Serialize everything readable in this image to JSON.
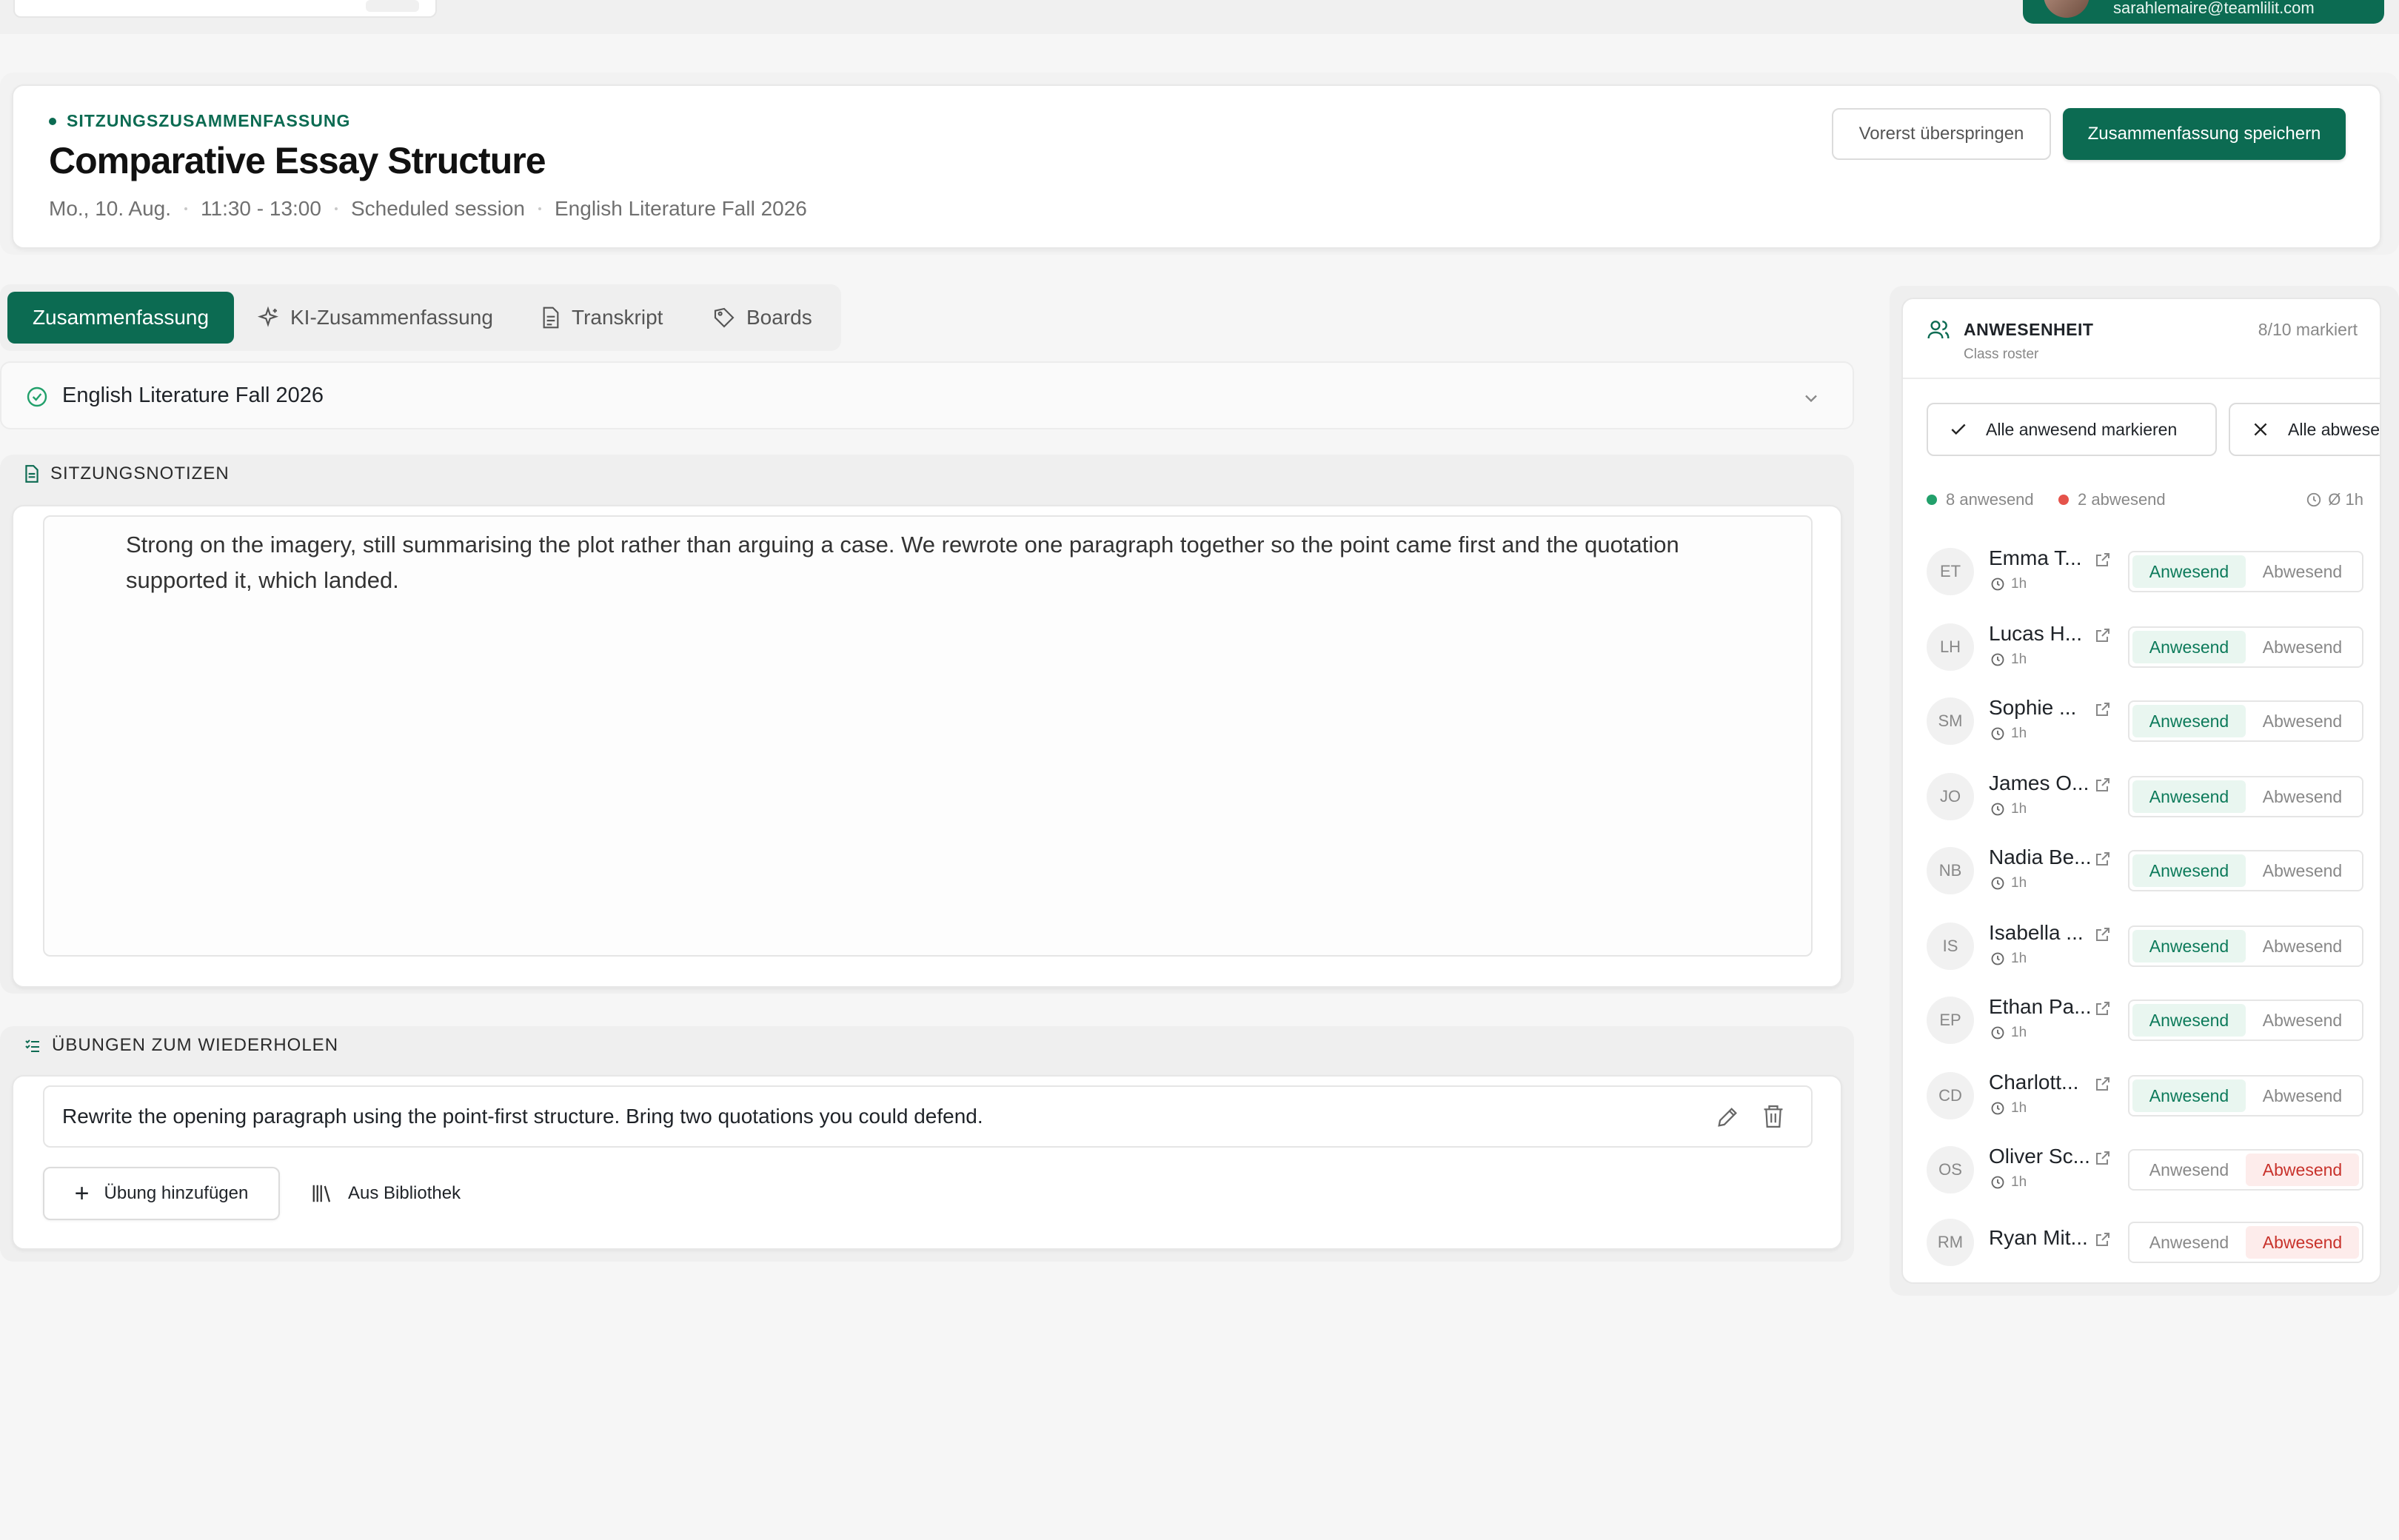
{
  "user": {
    "email": "sarahlemaire@teamlilit.com"
  },
  "header": {
    "kicker": "SITZUNGSZUSAMMENFASSUNG",
    "title": "Comparative Essay Structure",
    "date": "Mo., 10. Aug.",
    "time": "11:30 - 13:00",
    "session_type": "Scheduled session",
    "course": "English Literature Fall 2026",
    "skip_label": "Vorerst überspringen",
    "save_label": "Zusammenfassung speichern"
  },
  "tabs": [
    {
      "label": "Zusammenfassung",
      "icon": "none",
      "active": true
    },
    {
      "label": "KI-Zusammenfassung",
      "icon": "sparkle-icon"
    },
    {
      "label": "Transkript",
      "icon": "document-icon"
    },
    {
      "label": "Boards",
      "icon": "board-icon"
    }
  ],
  "course_select": {
    "label": "English Literature Fall 2026"
  },
  "notes": {
    "title": "SITZUNGSNOTIZEN",
    "text": "Strong on the imagery, still summarising the plot rather than arguing a case. We rewrote one paragraph together so the point came first and the quotation supported it, which landed."
  },
  "exercises": {
    "title": "ÜBUNGEN ZUM WIEDERHOLEN",
    "items": [
      "Rewrite the opening paragraph using the point-first structure. Bring two quotations you could defend."
    ],
    "add_label": "Übung hinzufügen",
    "library_label": "Aus Bibliothek"
  },
  "attendance": {
    "title": "ANWESENHEIT",
    "subtitle": "Class roster",
    "count": "8/10 markiert",
    "all_present_label": "Alle anwesend markieren",
    "all_absent_label": "Alle abwesend",
    "present_count": "8 anwesend",
    "absent_count": "2 abwesend",
    "avg": "Ø 1h",
    "present_label": "Anwesend",
    "absent_label": "Abwesend",
    "colors": {
      "present": "#22a06b",
      "absent": "#e5534b",
      "brand": "#0c6b52"
    },
    "students": [
      {
        "initials": "ET",
        "name": "Emma T...",
        "duration": "1h",
        "status": "present"
      },
      {
        "initials": "LH",
        "name": "Lucas H...",
        "duration": "1h",
        "status": "present"
      },
      {
        "initials": "SM",
        "name": "Sophie ...",
        "duration": "1h",
        "status": "present"
      },
      {
        "initials": "JO",
        "name": "James O...",
        "duration": "1h",
        "status": "present"
      },
      {
        "initials": "NB",
        "name": "Nadia Be...",
        "duration": "1h",
        "status": "present"
      },
      {
        "initials": "IS",
        "name": "Isabella ...",
        "duration": "1h",
        "status": "present"
      },
      {
        "initials": "EP",
        "name": "Ethan Pa...",
        "duration": "1h",
        "status": "present"
      },
      {
        "initials": "CD",
        "name": "Charlott...",
        "duration": "1h",
        "status": "present"
      },
      {
        "initials": "OS",
        "name": "Oliver Sc...",
        "duration": "1h",
        "status": "absent"
      },
      {
        "initials": "RM",
        "name": "Ryan Mit...",
        "duration": "",
        "status": "absent"
      }
    ]
  }
}
